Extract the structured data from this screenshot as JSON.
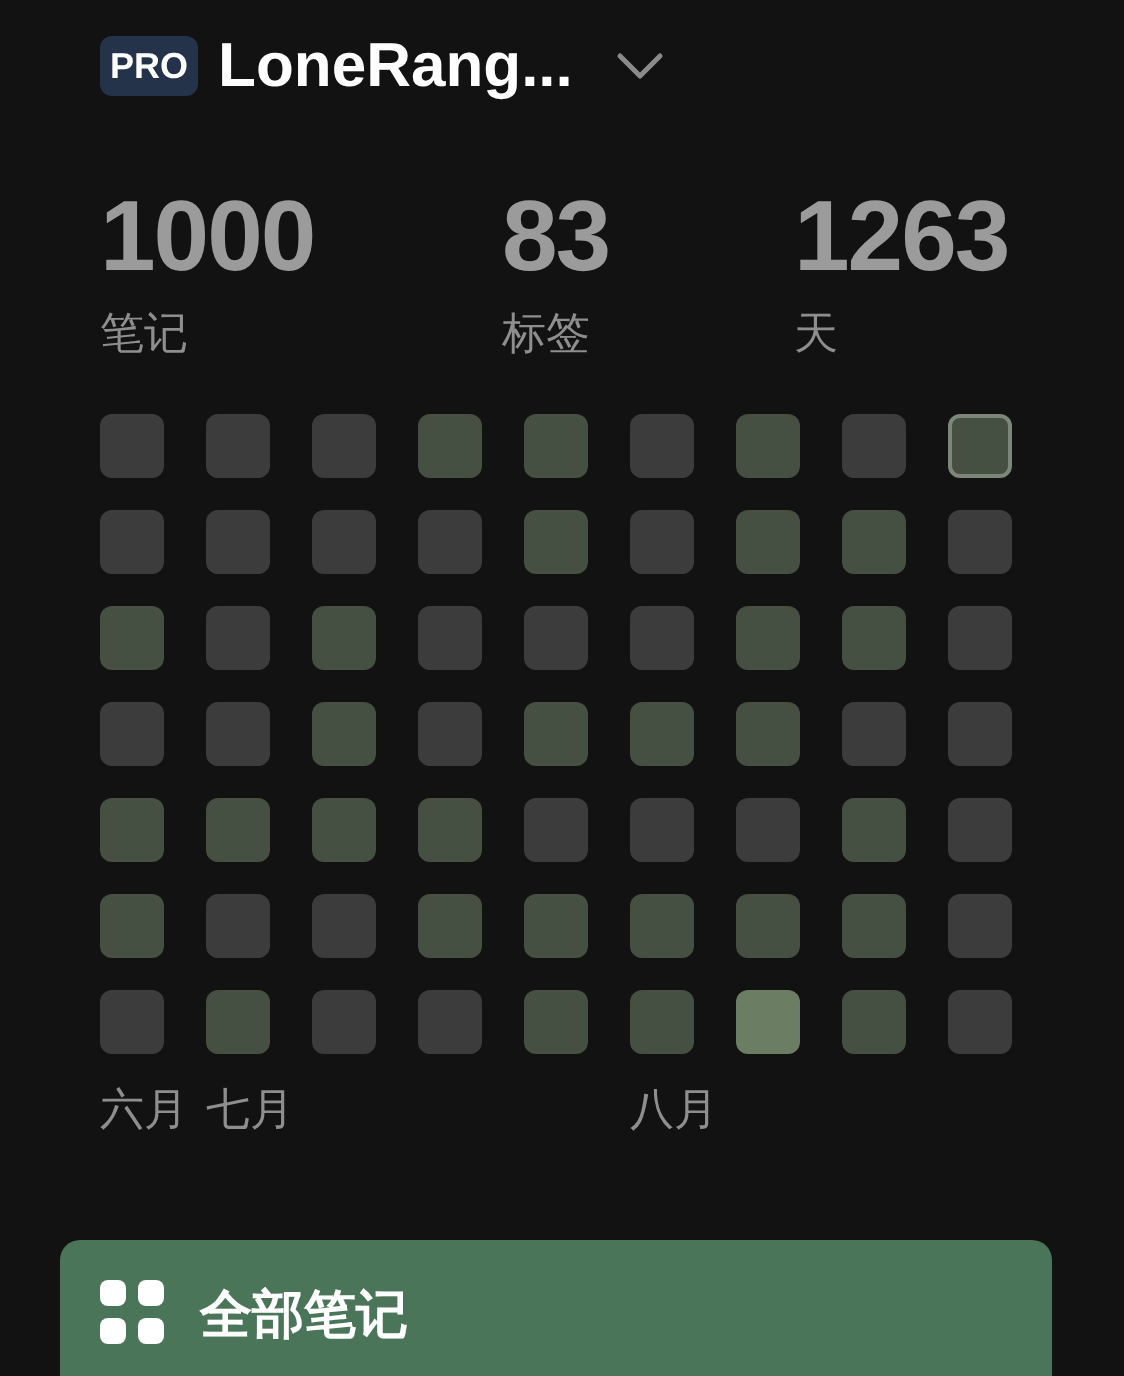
{
  "header": {
    "badge": "PRO",
    "title": "LoneRang..."
  },
  "stats": [
    {
      "value": "1000",
      "label": "笔记"
    },
    {
      "value": "83",
      "label": "标签"
    },
    {
      "value": "1263",
      "label": "天"
    }
  ],
  "heatmap": {
    "rows": [
      [
        {
          "color": "#3c3c3c",
          "selected": false
        },
        {
          "color": "#3c3c3c",
          "selected": false
        },
        {
          "color": "#3c3c3c",
          "selected": false
        },
        {
          "color": "#465042",
          "selected": false
        },
        {
          "color": "#465042",
          "selected": false
        },
        {
          "color": "#3c3c3c",
          "selected": false
        },
        {
          "color": "#465042",
          "selected": false
        },
        {
          "color": "#3c3c3c",
          "selected": false
        },
        {
          "color": "#465042",
          "selected": true
        }
      ],
      [
        {
          "color": "#3c3c3c",
          "selected": false
        },
        {
          "color": "#3c3c3c",
          "selected": false
        },
        {
          "color": "#3c3c3c",
          "selected": false
        },
        {
          "color": "#3c3c3c",
          "selected": false
        },
        {
          "color": "#465042",
          "selected": false
        },
        {
          "color": "#3c3c3c",
          "selected": false
        },
        {
          "color": "#465042",
          "selected": false
        },
        {
          "color": "#465042",
          "selected": false
        },
        {
          "color": "#3c3c3c",
          "selected": false
        }
      ],
      [
        {
          "color": "#465042",
          "selected": false
        },
        {
          "color": "#3c3c3c",
          "selected": false
        },
        {
          "color": "#465042",
          "selected": false
        },
        {
          "color": "#3c3c3c",
          "selected": false
        },
        {
          "color": "#3c3c3c",
          "selected": false
        },
        {
          "color": "#3c3c3c",
          "selected": false
        },
        {
          "color": "#465042",
          "selected": false
        },
        {
          "color": "#465042",
          "selected": false
        },
        {
          "color": "#3c3c3c",
          "selected": false
        }
      ],
      [
        {
          "color": "#3c3c3c",
          "selected": false
        },
        {
          "color": "#3c3c3c",
          "selected": false
        },
        {
          "color": "#465042",
          "selected": false
        },
        {
          "color": "#3c3c3c",
          "selected": false
        },
        {
          "color": "#465042",
          "selected": false
        },
        {
          "color": "#465042",
          "selected": false
        },
        {
          "color": "#465042",
          "selected": false
        },
        {
          "color": "#3c3c3c",
          "selected": false
        },
        {
          "color": "#3c3c3c",
          "selected": false
        }
      ],
      [
        {
          "color": "#465042",
          "selected": false
        },
        {
          "color": "#465042",
          "selected": false
        },
        {
          "color": "#465042",
          "selected": false
        },
        {
          "color": "#465042",
          "selected": false
        },
        {
          "color": "#3c3c3c",
          "selected": false
        },
        {
          "color": "#3c3c3c",
          "selected": false
        },
        {
          "color": "#3c3c3c",
          "selected": false
        },
        {
          "color": "#465042",
          "selected": false
        },
        {
          "color": "#3c3c3c",
          "selected": false
        }
      ],
      [
        {
          "color": "#465042",
          "selected": false
        },
        {
          "color": "#3c3c3c",
          "selected": false
        },
        {
          "color": "#3c3c3c",
          "selected": false
        },
        {
          "color": "#465042",
          "selected": false
        },
        {
          "color": "#465042",
          "selected": false
        },
        {
          "color": "#465042",
          "selected": false
        },
        {
          "color": "#465042",
          "selected": false
        },
        {
          "color": "#465042",
          "selected": false
        },
        {
          "color": "#3c3c3c",
          "selected": false
        }
      ],
      [
        {
          "color": "#3c3c3c",
          "selected": false
        },
        {
          "color": "#465042",
          "selected": false
        },
        {
          "color": "#3c3c3c",
          "selected": false
        },
        {
          "color": "#3c3c3c",
          "selected": false
        },
        {
          "color": "#465042",
          "selected": false
        },
        {
          "color": "#465042",
          "selected": false
        },
        {
          "color": "#6b7d63",
          "selected": false
        },
        {
          "color": "#465042",
          "selected": false
        },
        {
          "color": "#3c3c3c",
          "selected": false
        }
      ]
    ],
    "months": [
      {
        "label": "六月"
      },
      {
        "label": "七月"
      },
      {
        "label": "八月"
      }
    ]
  },
  "nav_button": {
    "label": "全部笔记"
  }
}
